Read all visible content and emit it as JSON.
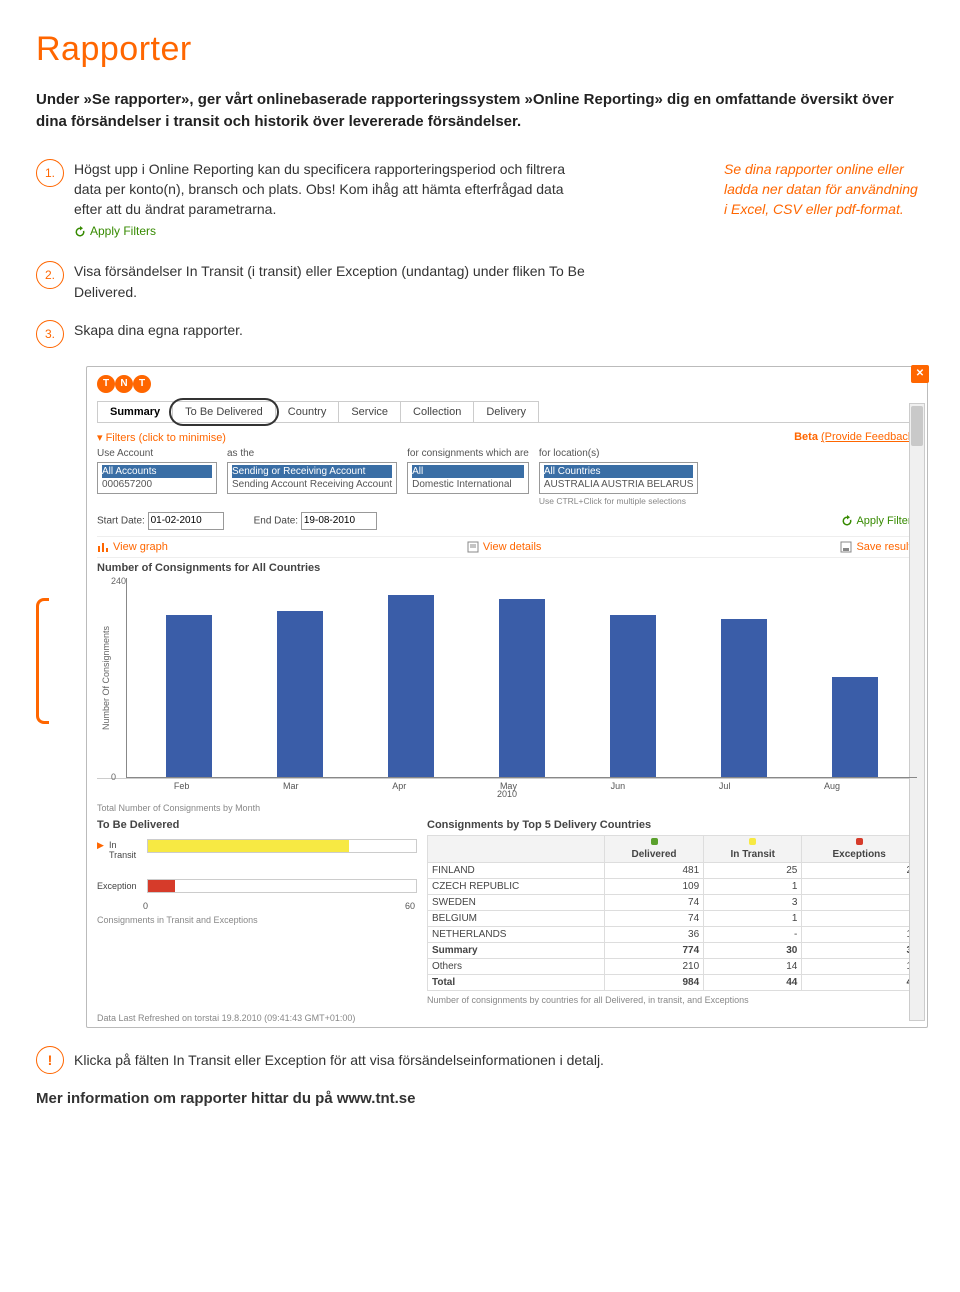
{
  "heading": "Rapporter",
  "intro": "Under »Se rapporter», ger vårt onlinebaserade rapporteringssystem »Online Reporting» dig en omfattande översikt över dina försändelser i transit och historik över levererade försändelser.",
  "step1": "Högst upp i Online Reporting kan du specificera rapporteringsperiod och filtrera data per konto(n), bransch och plats. Obs! Kom ihåg att hämta efterfrågad data efter att du ändrat parametrarna.",
  "apply_filters_label": "Apply Filters",
  "sidenote": "Se dina rapporter online eller ladda ner datan för användning i Excel, CSV eller pdf-format.",
  "step2": "Visa försändelser In Transit (i transit) eller Exception (undantag) under fliken To Be Delivered.",
  "step3": "Skapa dina egna rapporter.",
  "tabs": [
    "Summary",
    "To Be Delivered",
    "Country",
    "Service",
    "Collection",
    "Delivery"
  ],
  "beta": "Beta",
  "provide_feedback": "(Provide Feedback)",
  "filters_header": "Filters (click to minimise)",
  "filters": {
    "use_account": "Use Account",
    "as_the": "as the",
    "for_cons": "for consignments which are",
    "for_loc": "for location(s)",
    "account_list": [
      "All Accounts",
      "000657200"
    ],
    "role_list": [
      "Sending or Receiving Account",
      "Sending Account",
      "Receiving Account"
    ],
    "type_list": [
      "All",
      "Domestic",
      "International"
    ],
    "loc_list": [
      "All Countries",
      "AUSTRALIA",
      "AUSTRIA",
      "BELARUS"
    ],
    "ctrl_tip": "Use CTRL+Click for multiple selections",
    "start_date_label": "Start Date:",
    "start_date": "01-02-2010",
    "end_date_label": "End Date:",
    "end_date": "19-08-2010"
  },
  "action_view_graph": "View graph",
  "action_view_details": "View details",
  "action_save_results": "Save results",
  "chart_title": "Number of Consignments for All Countries",
  "chart_ylabel": "Number Of Consignments",
  "total_caption": "Total Number of Consignments by Month",
  "tbd_title": "To Be Delivered",
  "top5_title": "Consignments by Top 5  Delivery Countries",
  "tbd_footer": "Consignments in Transit and Exceptions",
  "top5_footer": "Number of consignments by countries for all Delivered, in transit, and Exceptions",
  "refreshed": "Data Last Refreshed on torstai 19.8.2010 (09:41:43 GMT+01:00)",
  "hbars": {
    "in_transit_label": "In Transit",
    "exception_label": "Exception",
    "xmin": "0",
    "xmax": "60"
  },
  "top5_headers": [
    "",
    "Delivered",
    "In Transit",
    "Exceptions"
  ],
  "top5_rows": [
    [
      "FINLAND",
      "481",
      "25",
      "2"
    ],
    [
      "CZECH REPUBLIC",
      "109",
      "1",
      "-"
    ],
    [
      "SWEDEN",
      "74",
      "3",
      "-"
    ],
    [
      "BELGIUM",
      "74",
      "1",
      "-"
    ],
    [
      "NETHERLANDS",
      "36",
      "-",
      "1"
    ]
  ],
  "top5_summary": [
    "Summary",
    "774",
    "30",
    "3"
  ],
  "top5_others": [
    "Others",
    "210",
    "14",
    "1"
  ],
  "top5_total": [
    "Total",
    "984",
    "44",
    "4"
  ],
  "hd_colors": {
    "delivered": "#5aa02c",
    "intransit": "#f7e943",
    "exceptions": "#d63b2a"
  },
  "warn": "Klicka på fälten In Transit eller Exception för att visa försändelseinformationen i detalj.",
  "final": "Mer information om rapporter hittar du på www.tnt.se",
  "chart_data": {
    "type": "bar",
    "title": "Number of Consignments for All Countries",
    "ylabel": "Number Of Consignments",
    "xlabel": "2010",
    "categories": [
      "Feb",
      "Mar",
      "Apr",
      "May",
      "Jun",
      "Jul",
      "Aug"
    ],
    "values": [
      195,
      200,
      220,
      215,
      195,
      190,
      120
    ],
    "ylim": [
      0,
      240
    ]
  },
  "tbd_data": {
    "type": "bar",
    "orientation": "horizontal",
    "categories": [
      "In Transit",
      "Exception"
    ],
    "values": [
      45,
      6
    ],
    "colors": [
      "#f7e943",
      "#d63b2a"
    ],
    "xlim": [
      0,
      60
    ]
  }
}
